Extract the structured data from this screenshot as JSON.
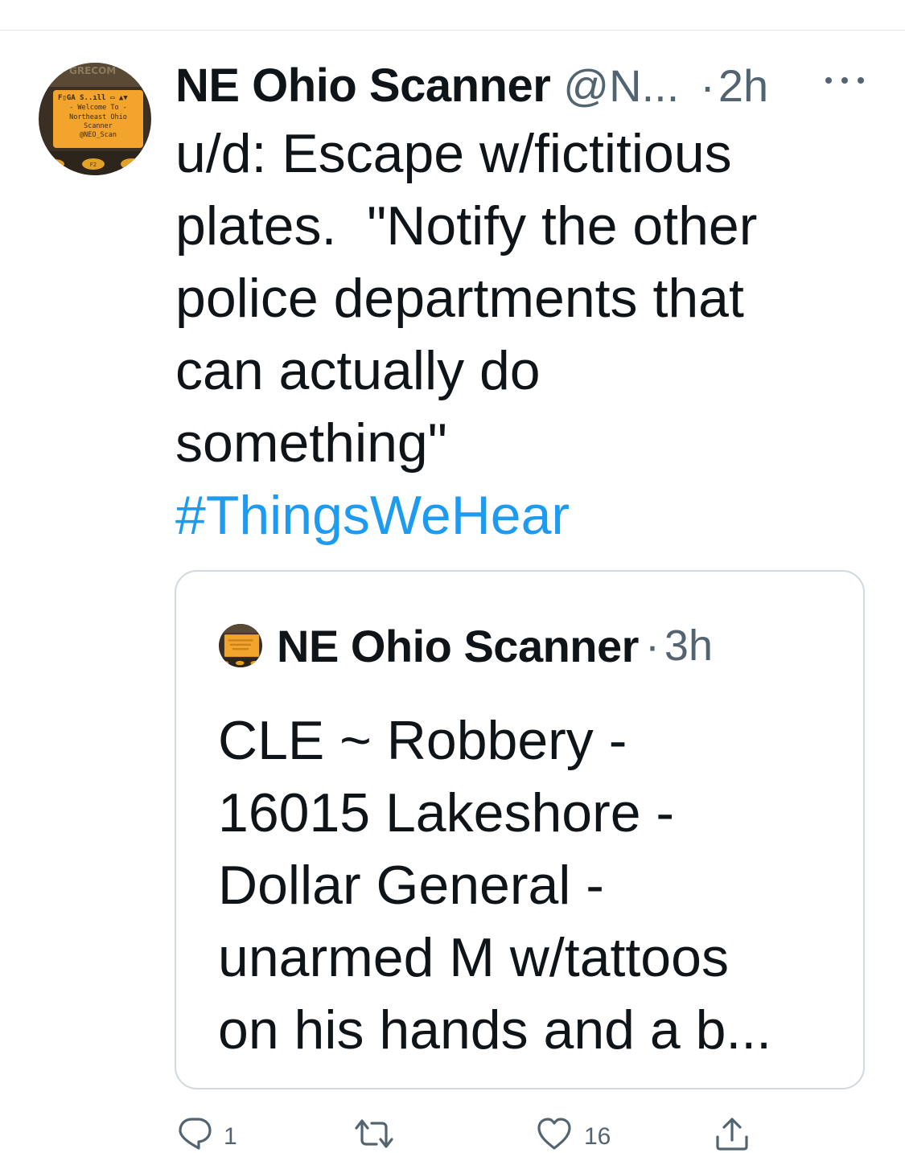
{
  "tweet": {
    "display_name": "NE Ohio Scanner",
    "handle": "@N...",
    "separator": "·",
    "time": "2h",
    "text_lines": [
      "u/d: Escape w/fictitious",
      "plates.  \"Notify the other",
      "police departments that",
      "can actually do",
      "something\""
    ],
    "hashtag": "#ThingsWeHear"
  },
  "quoted_tweet": {
    "display_name": "NE Ohio Scanner",
    "separator": "·",
    "time": "3h",
    "text_lines": [
      "CLE ~ Robbery -",
      "16015 Lakeshore -",
      "Dollar General -",
      "unarmed M w/tattoos",
      "on his hands and a b..."
    ]
  },
  "avatar": {
    "brand": "GRECOM",
    "status_line": "F▯GA S..ıll ▭ ▲▼",
    "screen_lines": [
      "- Welcome To -",
      "Northeast Ohio",
      "Scanner",
      "@NEO_Scan"
    ],
    "key_label": "F2"
  },
  "actions": {
    "reply": {
      "icon": "reply-icon",
      "count": "1"
    },
    "retweet": {
      "icon": "retweet-icon",
      "count": ""
    },
    "like": {
      "icon": "heart-icon",
      "count": "16"
    },
    "share": {
      "icon": "share-icon",
      "count": ""
    }
  },
  "colors": {
    "text": "#0f1419",
    "secondary": "#536471",
    "link": "#1d9bf0",
    "border": "#cfd9de",
    "scanner_screen": "#f3a42c"
  }
}
